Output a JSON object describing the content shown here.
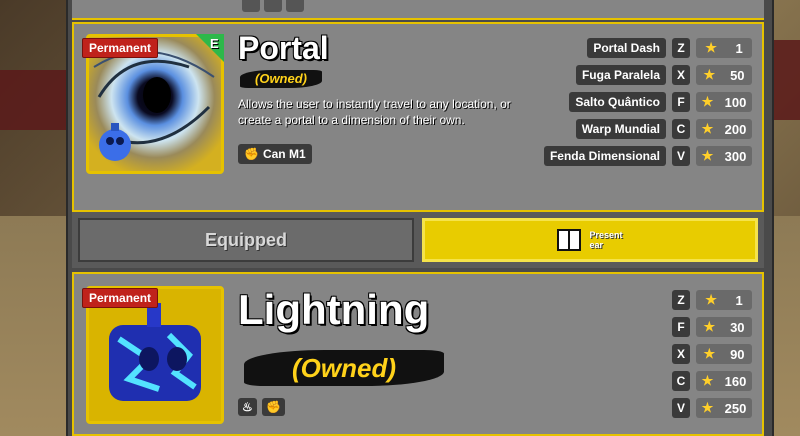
{
  "cards": [
    {
      "badge": "Permanent",
      "tier": "E",
      "title": "Portal",
      "status": "(Owned)",
      "description": "Allows the user to instantly travel to any location, or create a portal to a dimension of their own.",
      "chip_label": "Can M1",
      "skills": [
        {
          "name": "Portal Dash",
          "key": "Z",
          "cost": "1"
        },
        {
          "name": "Fuga Paralela",
          "key": "X",
          "cost": "50"
        },
        {
          "name": "Salto Quântico",
          "key": "F",
          "cost": "100"
        },
        {
          "name": "Warp Mundial",
          "key": "C",
          "cost": "200"
        },
        {
          "name": "Fenda Dimensional",
          "key": "V",
          "cost": "300"
        }
      ]
    },
    {
      "badge": "Permanent",
      "title": "Lightning",
      "status": "(Owned)",
      "skills": [
        {
          "key": "Z",
          "cost": "1"
        },
        {
          "key": "F",
          "cost": "30"
        },
        {
          "key": "X",
          "cost": "90"
        },
        {
          "key": "C",
          "cost": "160"
        },
        {
          "key": "V",
          "cost": "250"
        }
      ]
    }
  ],
  "buttons": {
    "equipped": "Equipped",
    "present": "Present\near"
  },
  "colors": {
    "accent": "#e6c200",
    "badge_red": "#c0221b",
    "tier_green": "#2db84a"
  },
  "icons": [
    "gift-icon",
    "fist-icon",
    "fire-icon",
    "star-icon"
  ]
}
